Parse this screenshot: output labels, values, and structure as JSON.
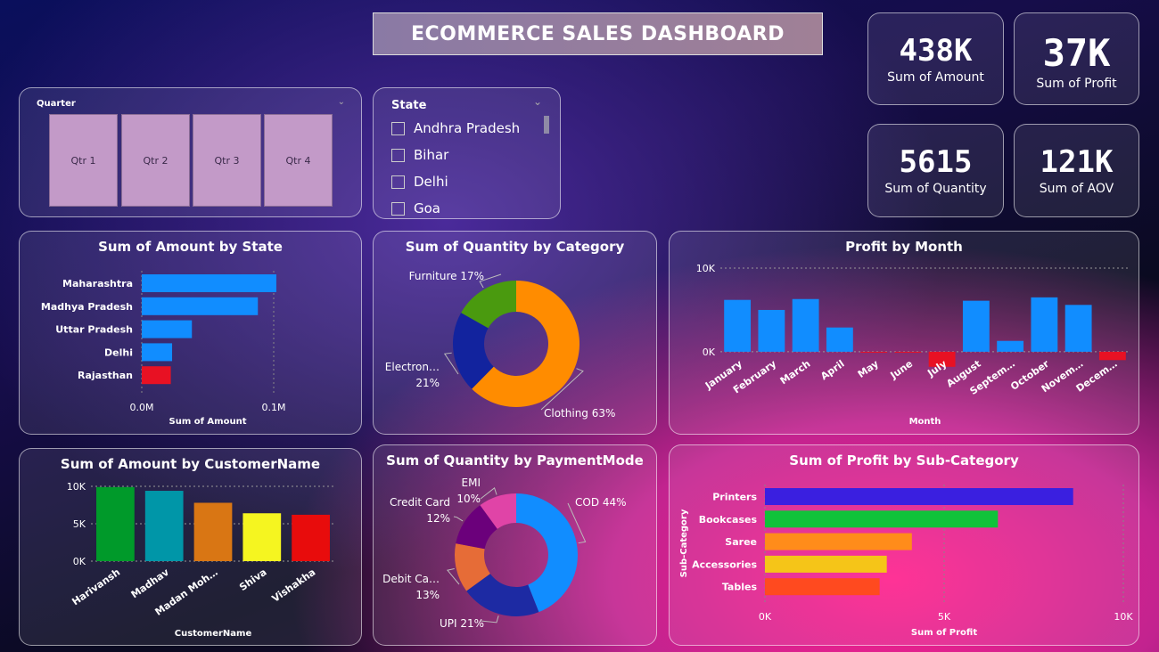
{
  "title": "ECOMMERCE SALES DASHBOARD",
  "kpis": [
    {
      "value": "438K",
      "label": "Sum of Amount"
    },
    {
      "value": "37K",
      "label": "Sum of Profit"
    },
    {
      "value": "5615",
      "label": "Sum of Quantity"
    },
    {
      "value": "121K",
      "label": "Sum of AOV"
    }
  ],
  "quarter_slicer": {
    "label": "Quarter",
    "options": [
      "Qtr 1",
      "Qtr 2",
      "Qtr 3",
      "Qtr 4"
    ]
  },
  "state_slicer": {
    "label": "State",
    "options": [
      "Andhra Pradesh",
      "Bihar",
      "Delhi",
      "Goa"
    ]
  },
  "colors": {
    "blue": "#118dff",
    "red": "#e81123"
  },
  "chart_data": [
    {
      "id": "amount_by_state",
      "type": "bar",
      "orientation": "horizontal",
      "title": "Sum of Amount by State",
      "xlabel": "Sum of Amount",
      "ylabel": "",
      "categories": [
        "Maharashtra",
        "Madhya Pradesh",
        "Uttar Pradesh",
        "Delhi",
        "Rajasthan"
      ],
      "values": [
        102000,
        88000,
        38000,
        23000,
        22000
      ],
      "bar_colors": [
        "#118dff",
        "#118dff",
        "#118dff",
        "#118dff",
        "#e81123"
      ],
      "xlim": [
        0,
        100000
      ],
      "ticks": [
        {
          "v": 0,
          "label": "0.0M"
        },
        {
          "v": 100000,
          "label": "0.1M"
        }
      ]
    },
    {
      "id": "quantity_by_category",
      "type": "pie",
      "donut": true,
      "title": "Sum of Quantity by Category",
      "slices": [
        {
          "label": "Clothing",
          "value": 63,
          "color": "#ff8c00"
        },
        {
          "label": "Electron…",
          "value": 21,
          "color": "#12239e"
        },
        {
          "label": "Furniture",
          "value": 17,
          "color": "#4a9a0f"
        }
      ]
    },
    {
      "id": "profit_by_month",
      "type": "bar",
      "title": "Profit by Month",
      "xlabel": "Month",
      "ylabel": "",
      "categories": [
        "January",
        "February",
        "March",
        "April",
        "May",
        "June",
        "July",
        "August",
        "Septem…",
        "October",
        "Novem…",
        "Decem…"
      ],
      "values": [
        6200,
        5000,
        6300,
        2900,
        -100,
        -100,
        -1800,
        6100,
        1300,
        6500,
        5600,
        -1000
      ],
      "ylim": [
        -2000,
        10000
      ],
      "ticks": [
        {
          "v": 0,
          "label": "0K"
        },
        {
          "v": 10000,
          "label": "10K"
        }
      ]
    },
    {
      "id": "amount_by_customer",
      "type": "bar",
      "title": "Sum of Amount by CustomerName",
      "xlabel": "CustomerName",
      "ylabel": "",
      "categories": [
        "Harivansh",
        "Madhav",
        "Madan Moh…",
        "Shiva",
        "Vishakha"
      ],
      "values": [
        9900,
        9400,
        7800,
        6400,
        6200
      ],
      "bar_colors": [
        "#009a2a",
        "#0096a8",
        "#d97614",
        "#f5f520",
        "#e80c0c"
      ],
      "ylim": [
        0,
        10000
      ],
      "ticks": [
        {
          "v": 0,
          "label": "0K"
        },
        {
          "v": 5000,
          "label": "5K"
        },
        {
          "v": 10000,
          "label": "10K"
        }
      ]
    },
    {
      "id": "quantity_by_paymentmode",
      "type": "pie",
      "donut": true,
      "title": "Sum of Quantity by PaymentMode",
      "slices": [
        {
          "label": "COD",
          "value": 44,
          "color": "#118dff"
        },
        {
          "label": "UPI",
          "value": 21,
          "color": "#1d2aa3"
        },
        {
          "label": "Debit Ca…",
          "value": 13,
          "color": "#e66c37"
        },
        {
          "label": "Credit Card",
          "value": 12,
          "color": "#6b007b"
        },
        {
          "label": "EMI",
          "value": 10,
          "color": "#e044a7"
        }
      ]
    },
    {
      "id": "profit_by_subcategory",
      "type": "bar",
      "orientation": "horizontal",
      "title": "Sum of Profit by Sub-Category",
      "xlabel": "Sum of Profit",
      "ylabel": "Sub-Category",
      "categories": [
        "Printers",
        "Bookcases",
        "Saree",
        "Accessories",
        "Tables"
      ],
      "values": [
        8600,
        6500,
        4100,
        3400,
        3200
      ],
      "bar_colors": [
        "#3a1fe0",
        "#10c23a",
        "#ff8c1a",
        "#f5c518",
        "#ff4a1f"
      ],
      "xlim": [
        0,
        10000
      ],
      "ticks": [
        {
          "v": 0,
          "label": "0K"
        },
        {
          "v": 5000,
          "label": "5K"
        },
        {
          "v": 10000,
          "label": "10K"
        }
      ]
    }
  ]
}
